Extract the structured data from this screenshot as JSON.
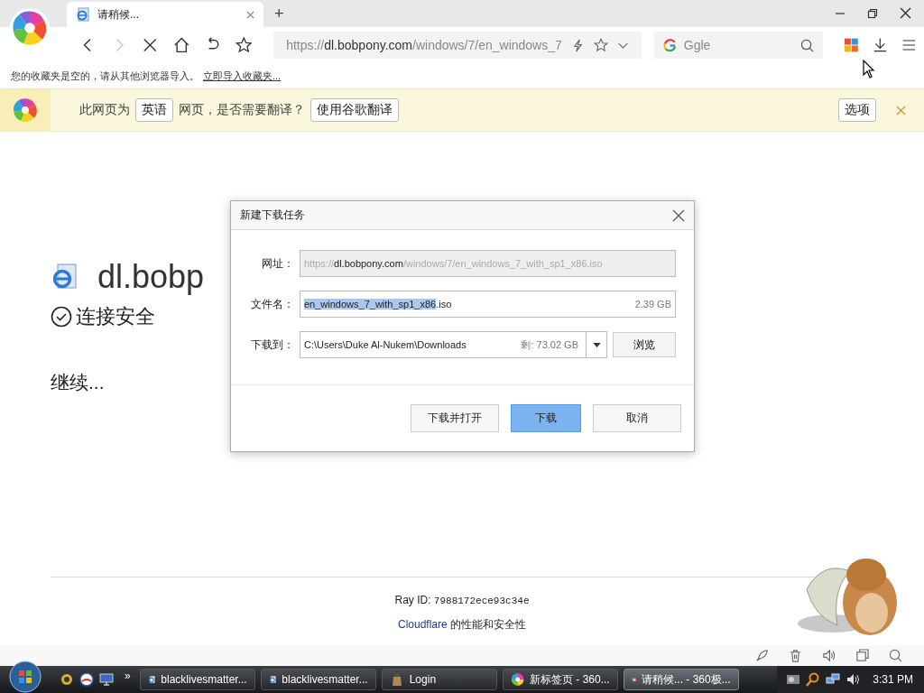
{
  "browser": {
    "tabs": [
      {
        "title": "请稍候...",
        "selected": true
      }
    ],
    "new_tab": "+",
    "address": {
      "scheme": "https://",
      "host": "dl.bobpony.com",
      "path": "/windows/7/en_windows_7"
    },
    "search": {
      "placeholder": "Ggle"
    },
    "forward_disabled": true
  },
  "bookmarks_bar": {
    "message": "您的收藏夹是空的，请从其他浏览器导入。",
    "link": "立即导入收藏夹..."
  },
  "translate_bar": {
    "before": "此网页为",
    "language": "英语",
    "after": "网页，是否需要翻译？",
    "translate_button": "使用谷歌翻译",
    "options_button": "选项"
  },
  "page": {
    "heading": "dl.bobp",
    "secure": "连接安全",
    "continue": "继续...",
    "ray_label": "Ray ID:",
    "ray_id": "7988172ece93c34e",
    "footer_link": "Cloudflare",
    "footer_text": "的性能和安全性"
  },
  "dialog": {
    "title": "新建下载任务",
    "url": {
      "label": "网址：",
      "scheme": "https://",
      "host": "dl.bobpony.com",
      "path": "/windows/7/en_windows_7_with_sp1_x86.iso",
      "disabled": true
    },
    "filename": {
      "label": "文件名：",
      "selected_part": "en_windows_7_with_sp1_x86",
      "rest": ".iso",
      "size": "2.39 GB"
    },
    "save_to": {
      "label": "下载到：",
      "path": "C:\\Users\\Duke Al-Nukem\\Downloads",
      "free": "剩: 73.02 GB",
      "browse": "浏览"
    },
    "buttons": [
      {
        "label": "下载并打开",
        "primary": false
      },
      {
        "label": "下载",
        "primary": true
      },
      {
        "label": "取消",
        "primary": false
      }
    ]
  },
  "taskbar": {
    "more": "»",
    "tasks": [
      {
        "label": "blacklivesmatter...",
        "kind": "ie",
        "selected": false
      },
      {
        "label": "blacklivesmatter...",
        "kind": "ie",
        "selected": false
      },
      {
        "label": "Login",
        "kind": "app",
        "selected": false
      },
      {
        "label": "新标签页 - 360...",
        "kind": "browser",
        "selected": false
      },
      {
        "label": "请稍候... - 360极...",
        "kind": "browser",
        "selected": true
      }
    ],
    "clock": "3:31 PM"
  }
}
